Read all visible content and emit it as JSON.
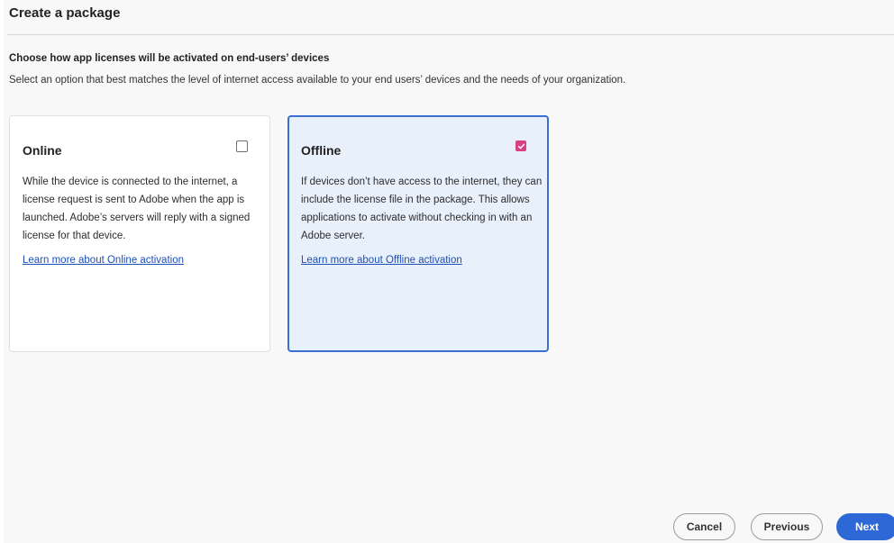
{
  "page": {
    "title": "Create a package"
  },
  "section": {
    "heading": "Choose how app licenses will be activated on end-users’ devices",
    "description": "Select an option that best matches the level of internet access available to your end users’ devices and the needs of your organization."
  },
  "options": [
    {
      "title": "Online",
      "checked": false,
      "body": "While the device is connected to the internet, a license request is sent to Adobe when the app is launched. Adobe’s servers will reply with a signed license for that device.",
      "link": "Learn more about Online activation"
    },
    {
      "title": "Offline",
      "checked": true,
      "body": "If devices don’t have access to the internet, they can include the license file in the package. This allows applications to activate without checking in with an Adobe server.",
      "link": "Learn more about Offline activation"
    }
  ],
  "footer": {
    "cancel_label": "Cancel",
    "previous_label": "Previous",
    "next_label": "Next"
  },
  "colors": {
    "selected_border": "#3b6fd4",
    "selected_bg": "#e8f0fc",
    "checkbox_checked": "#d93f86",
    "primary_button": "#2e68d6",
    "link": "#1f4fb5"
  }
}
